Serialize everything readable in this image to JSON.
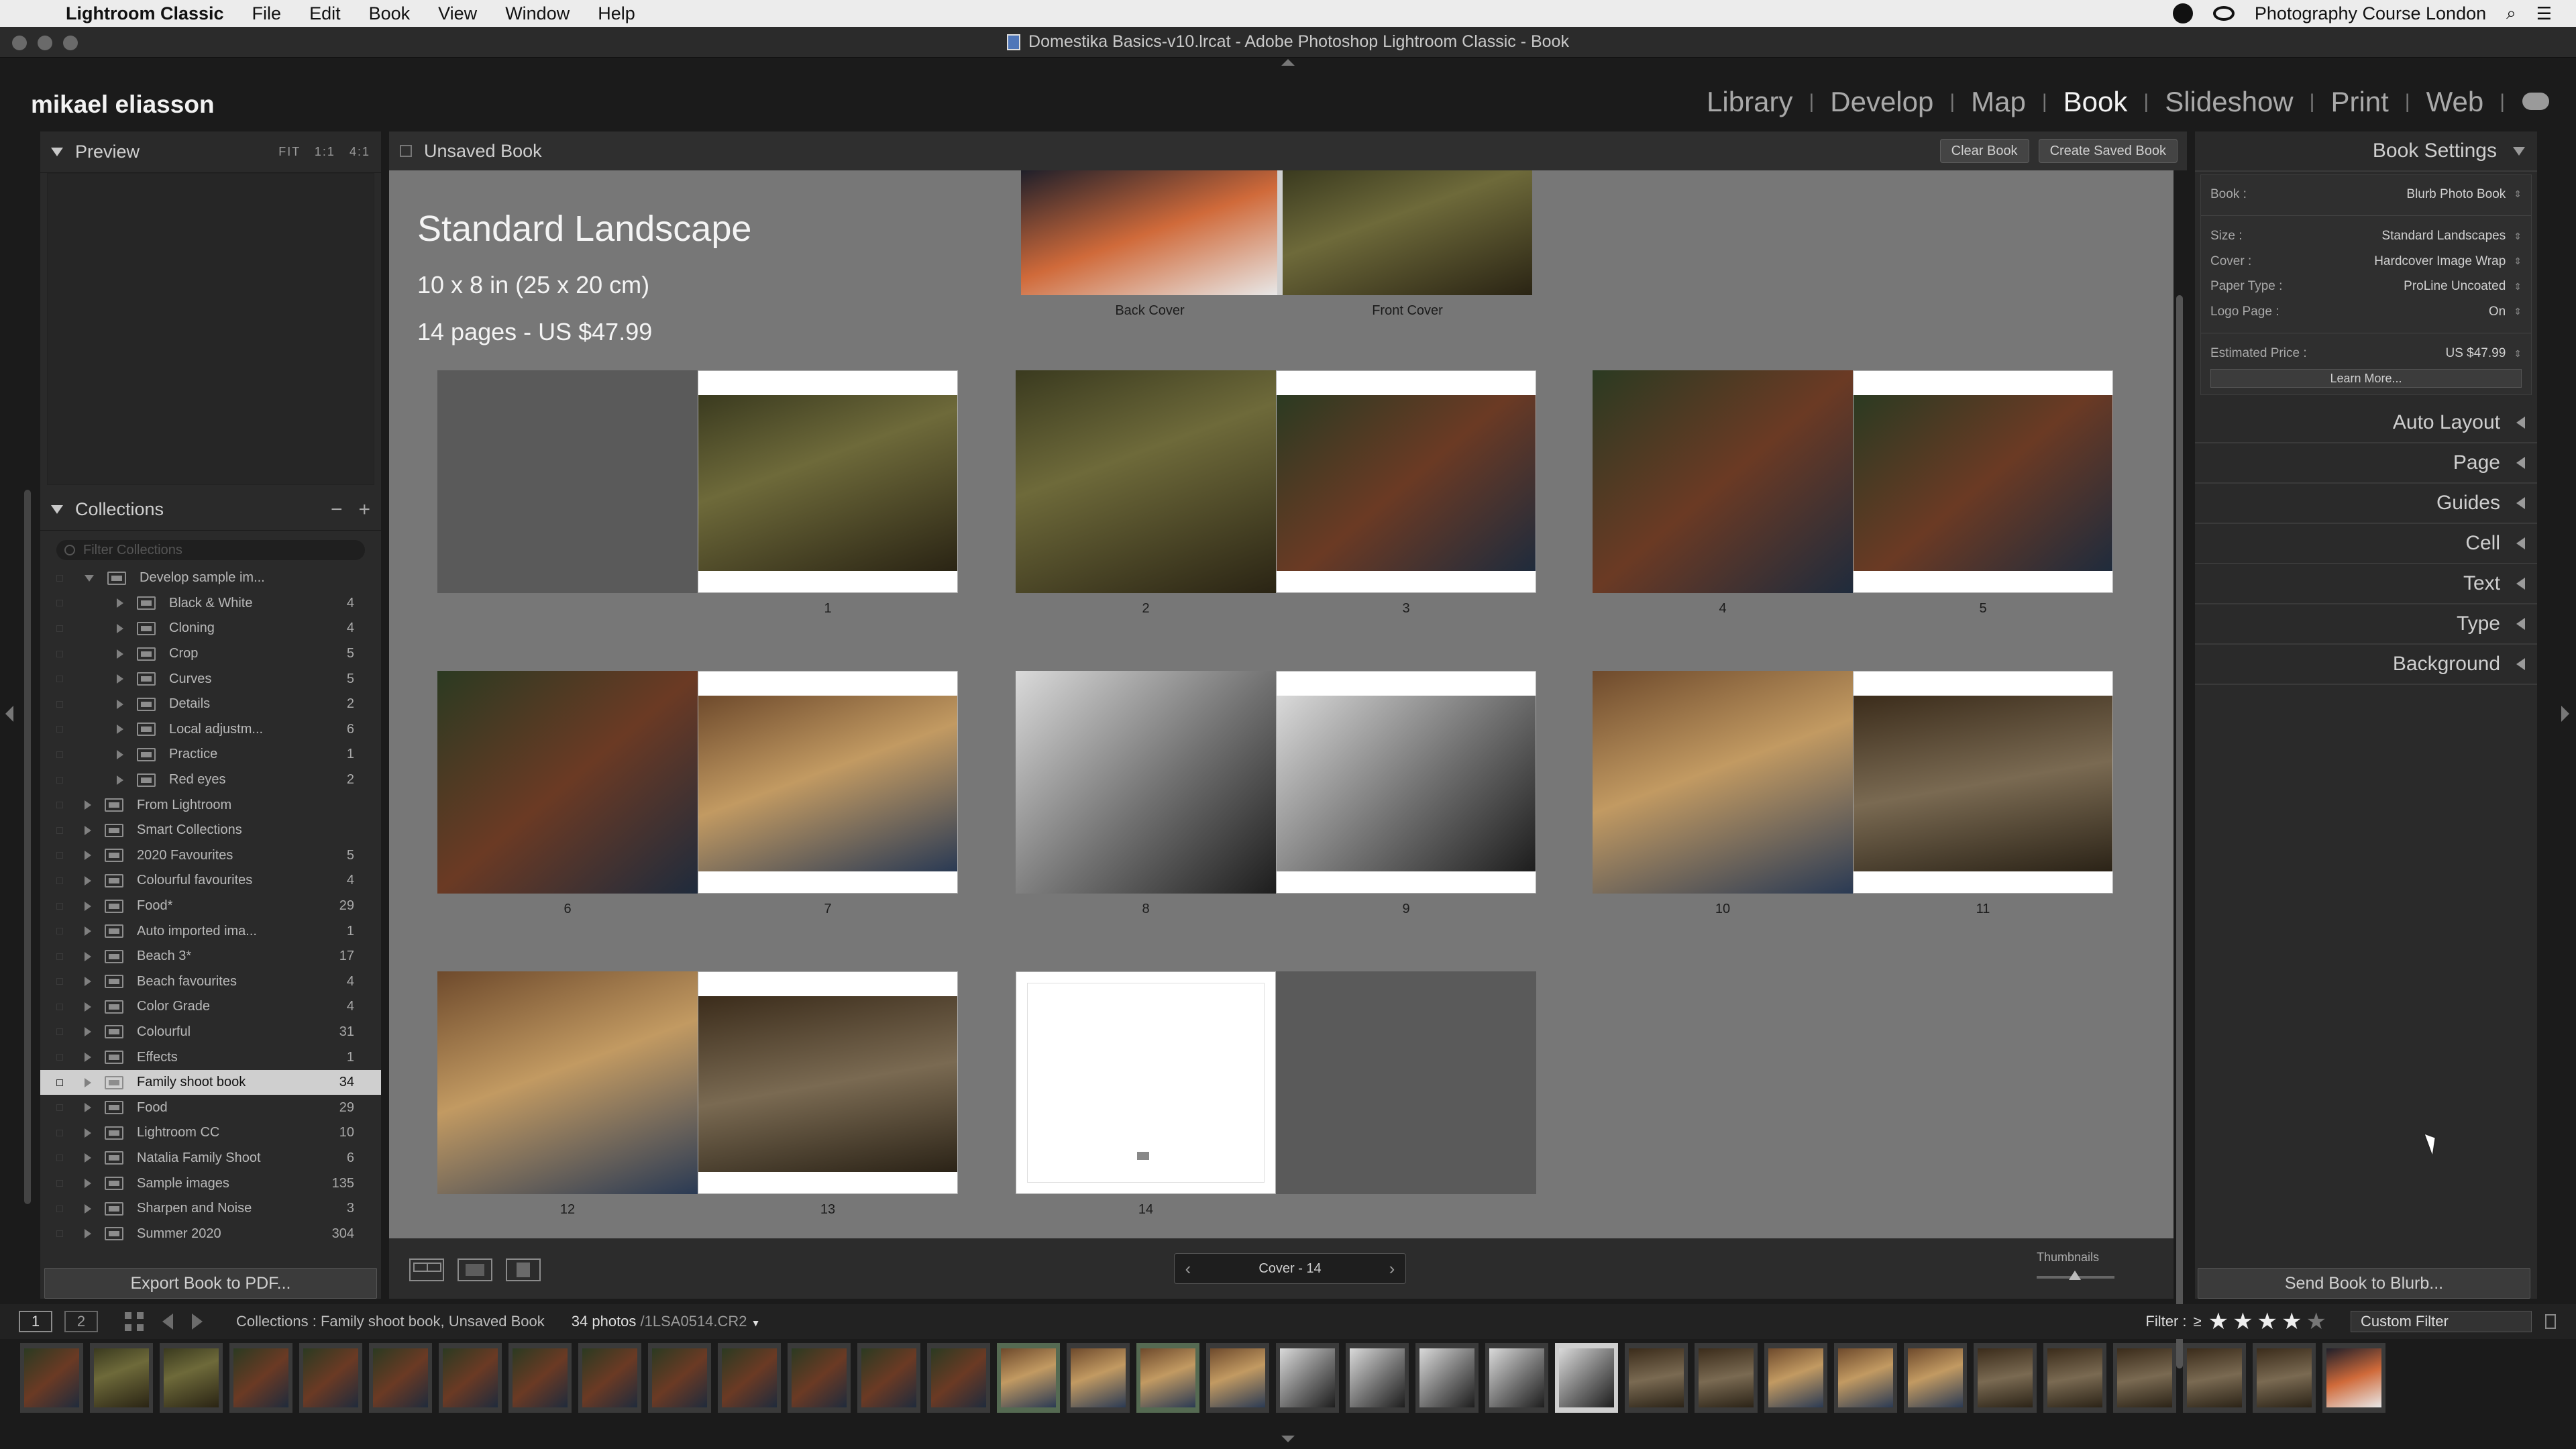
{
  "menubar": {
    "app": "Lightroom Classic",
    "items": [
      "File",
      "Edit",
      "Book",
      "View",
      "Window",
      "Help"
    ],
    "right_text": "Photography Course London"
  },
  "window": {
    "title": "Domestika Basics-v10.lrcat - Adobe Photoshop Lightroom Classic - Book"
  },
  "identity": "mikael eliasson",
  "modules": [
    "Library",
    "Develop",
    "Map",
    "Book",
    "Slideshow",
    "Print",
    "Web"
  ],
  "active_module": "Book",
  "preview": {
    "title": "Preview",
    "zoom": [
      "FIT",
      "1:1",
      "4:1"
    ]
  },
  "collections": {
    "title": "Collections",
    "filter_placeholder": "Filter Collections",
    "items": [
      {
        "name": "Develop sample im...",
        "count": "",
        "level": 1,
        "expanded": true
      },
      {
        "name": "Black & White",
        "count": "4",
        "level": 2
      },
      {
        "name": "Cloning",
        "count": "4",
        "level": 2
      },
      {
        "name": "Crop",
        "count": "5",
        "level": 2
      },
      {
        "name": "Curves",
        "count": "5",
        "level": 2
      },
      {
        "name": "Details",
        "count": "2",
        "level": 2
      },
      {
        "name": "Local adjustm...",
        "count": "6",
        "level": 2
      },
      {
        "name": "Practice",
        "count": "1",
        "level": 2
      },
      {
        "name": "Red eyes",
        "count": "2",
        "level": 2
      },
      {
        "name": "From Lightroom",
        "count": "",
        "level": 1
      },
      {
        "name": "Smart Collections",
        "count": "",
        "level": 1
      },
      {
        "name": "2020 Favourites",
        "count": "5",
        "level": 1
      },
      {
        "name": "Colourful favourites",
        "count": "4",
        "level": 1
      },
      {
        "name": "Food*",
        "count": "29",
        "level": 1
      },
      {
        "name": "Auto imported ima...",
        "count": "1",
        "level": 1
      },
      {
        "name": "Beach 3*",
        "count": "17",
        "level": 1
      },
      {
        "name": "Beach favourites",
        "count": "4",
        "level": 1
      },
      {
        "name": "Color Grade",
        "count": "4",
        "level": 1
      },
      {
        "name": "Colourful",
        "count": "31",
        "level": 1
      },
      {
        "name": "Effects",
        "count": "1",
        "level": 1
      },
      {
        "name": "Family shoot book",
        "count": "34",
        "level": 1,
        "selected": true
      },
      {
        "name": "Food",
        "count": "29",
        "level": 1
      },
      {
        "name": "Lightroom CC",
        "count": "10",
        "level": 1
      },
      {
        "name": "Natalia Family Shoot",
        "count": "6",
        "level": 1
      },
      {
        "name": "Sample images",
        "count": "135",
        "level": 1
      },
      {
        "name": "Sharpen and Noise",
        "count": "3",
        "level": 1
      },
      {
        "name": "Summer 2020",
        "count": "304",
        "level": 1
      }
    ]
  },
  "export_button": "Export Book to PDF...",
  "book_header": {
    "title": "Unsaved Book",
    "clear": "Clear Book",
    "create": "Create Saved Book"
  },
  "book_info": {
    "title": "Standard Landscape",
    "size": "10 x 8 in (25 x 20 cm)",
    "pages": "14 pages - US $47.99"
  },
  "cover_labels": {
    "back": "Back Cover",
    "front": "Front Cover"
  },
  "page_numbers": [
    "1",
    "2",
    "3",
    "4",
    "5",
    "6",
    "7",
    "8",
    "9",
    "10",
    "11",
    "12",
    "13",
    "14"
  ],
  "pager": {
    "text": "Cover - 14"
  },
  "thumbnails_label": "Thumbnails",
  "book_settings": {
    "title": "Book Settings",
    "rows": [
      {
        "label": "Book :",
        "value": "Blurb Photo Book"
      },
      {
        "label": "Size :",
        "value": "Standard Landscapes"
      },
      {
        "label": "Cover :",
        "value": "Hardcover Image Wrap"
      },
      {
        "label": "Paper Type :",
        "value": "ProLine Uncoated"
      },
      {
        "label": "Logo Page :",
        "value": "On"
      },
      {
        "label": "Estimated Price :",
        "value": "US $47.99"
      }
    ],
    "learn_more": "Learn More..."
  },
  "right_panels": [
    "Auto Layout",
    "Page",
    "Guides",
    "Cell",
    "Text",
    "Type",
    "Background"
  ],
  "send_button": "Send Book to Blurb...",
  "filmstrip": {
    "screens": [
      "1",
      "2"
    ],
    "source": "Collections : Family shoot book, Unsaved Book",
    "count": "34 photos",
    "filename": "/1LSA0514.CR2",
    "filter_label": "Filter :",
    "filter_op": "≥",
    "stars_on": "★★★★",
    "stars_off": "★",
    "custom_filter": "Custom Filter"
  },
  "colors": {
    "canvas": "#777777",
    "panel": "#2a2a2a",
    "selected": "#cfcfcf"
  }
}
